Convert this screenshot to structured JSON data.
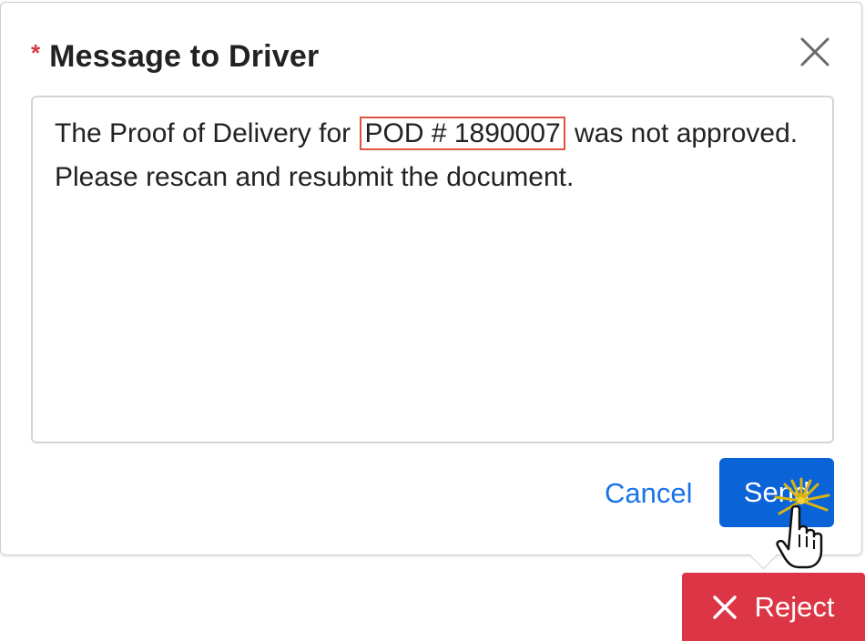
{
  "dialog": {
    "required_marker": "*",
    "title": "Message to Driver",
    "close_icon": "close-icon"
  },
  "message": {
    "before": "The Proof of Delivery for",
    "highlight": "POD # 1890007",
    "after": "was not approved. Please rescan and resubmit the document."
  },
  "actions": {
    "cancel_label": "Cancel",
    "send_label": "Send"
  },
  "footer": {
    "reject_label": "Reject",
    "reject_icon": "x-icon"
  },
  "colors": {
    "accent": "#0b63d8",
    "link": "#1a73e8",
    "danger": "#dc3545",
    "highlight_border": "#e0533f",
    "required": "#d9363e"
  }
}
